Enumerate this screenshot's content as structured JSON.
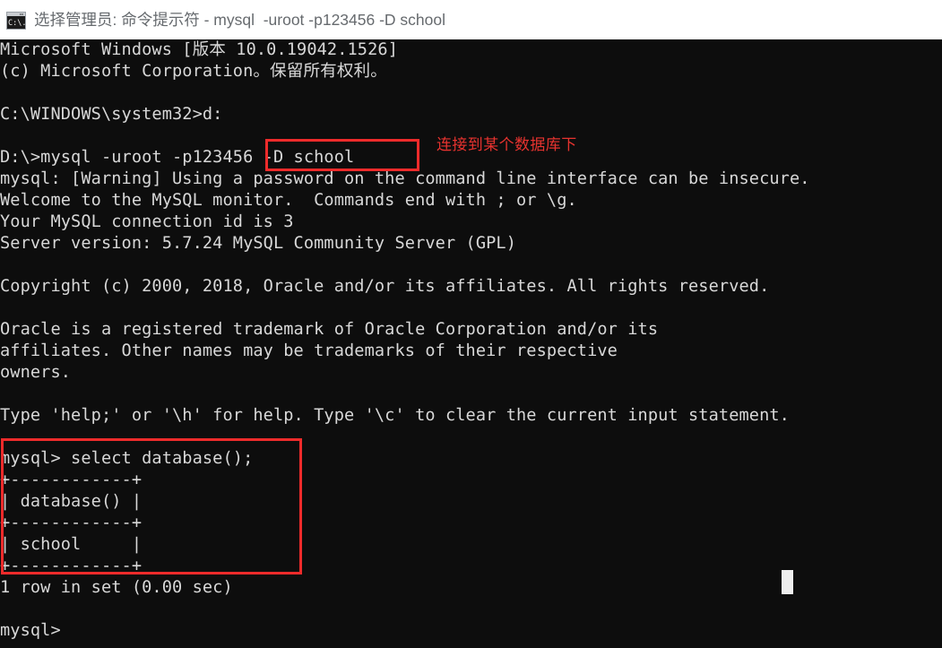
{
  "window": {
    "title": "选择管理员: 命令提示符 - mysql  -uroot -p123456 -D school",
    "icon": "cmd-console-icon",
    "background_color": "#0d0d0d",
    "text_color": "#d8d8d8",
    "titlebar_color": "#ffffff",
    "titlebar_text_color": "#666a6e"
  },
  "console": {
    "lines": [
      "Microsoft Windows [版本 10.0.19042.1526]",
      "(c) Microsoft Corporation。保留所有权利。",
      "",
      "C:\\WINDOWS\\system32>d:",
      "",
      "D:\\>mysql -uroot -p123456 -D school",
      "mysql: [Warning] Using a password on the command line interface can be insecure.",
      "Welcome to the MySQL monitor.  Commands end with ; or \\g.",
      "Your MySQL connection id is 3",
      "Server version: 5.7.24 MySQL Community Server (GPL)",
      "",
      "Copyright (c) 2000, 2018, Oracle and/or its affiliates. All rights reserved.",
      "",
      "Oracle is a registered trademark of Oracle Corporation and/or its",
      "affiliates. Other names may be trademarks of their respective",
      "owners.",
      "",
      "Type 'help;' or '\\h' for help. Type '\\c' to clear the current input statement.",
      "",
      "mysql> select database();",
      "+------------+",
      "| database() |",
      "+------------+",
      "| school     |",
      "+------------+",
      "1 row in set (0.00 sec)",
      "",
      "mysql>"
    ],
    "caret": {
      "visible": true,
      "color": "#eeeeee"
    }
  },
  "annotations": {
    "accent_color": "#ee2b2b",
    "highlight_command": {
      "label": "-D school",
      "note": "连接到某个数据库下",
      "note_color": "#e8332f"
    },
    "highlight_result": {
      "label": "mysql> select database(); result table"
    }
  },
  "query_result": {
    "statement": "select database();",
    "columns": [
      "database()"
    ],
    "rows": [
      [
        "school"
      ]
    ],
    "summary": "1 row in set (0.00 sec)"
  }
}
